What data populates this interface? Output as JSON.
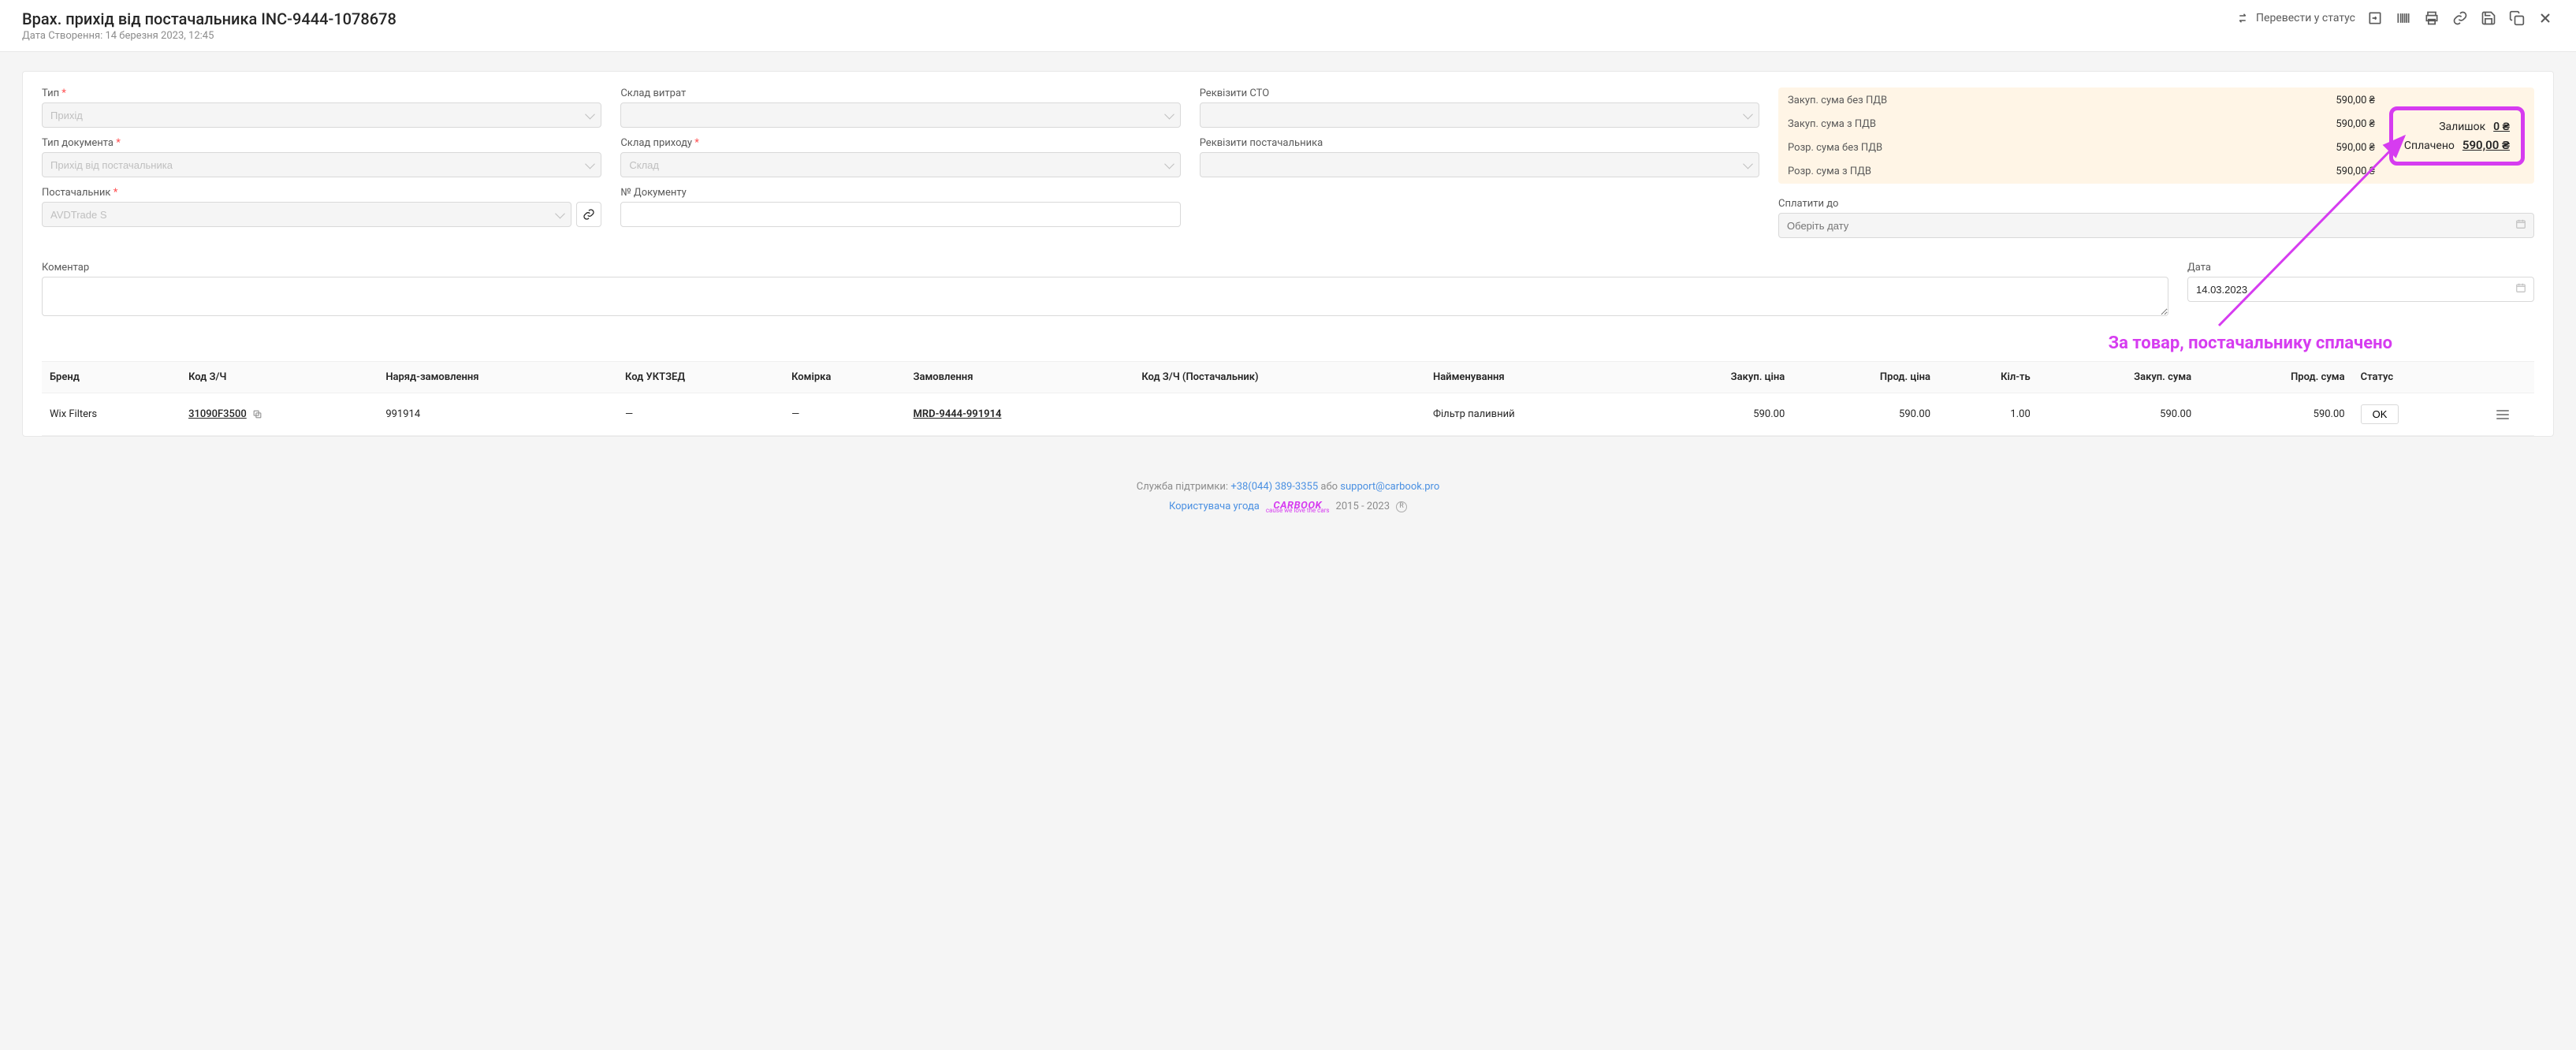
{
  "header": {
    "title": "Врах. прихід від постачальника INC-9444-1078678",
    "subtitle": "Дата Створення: 14 березня 2023, 12:45",
    "status_label": "Перевести у статус"
  },
  "form": {
    "type": {
      "label": "Тип",
      "value": "Прихід"
    },
    "doc_type": {
      "label": "Тип документа",
      "value": "Прихід від постачальника"
    },
    "supplier": {
      "label": "Постачальник",
      "value": "AVDTrade S"
    },
    "expense_wh": {
      "label": "Склад витрат",
      "value": ""
    },
    "income_wh": {
      "label": "Склад приходу",
      "value": "Склад"
    },
    "doc_no": {
      "label": "№ Документу",
      "value": ""
    },
    "sto_req": {
      "label": "Реквізити СТО",
      "value": ""
    },
    "supp_req": {
      "label": "Реквізити постачальника",
      "value": ""
    }
  },
  "summary": {
    "buy_no_vat": {
      "label": "Закуп. сума без ПДВ",
      "value": "590,00 ₴"
    },
    "buy_vat": {
      "label": "Закуп. сума з ПДВ",
      "value": "590,00 ₴"
    },
    "calc_no_vat": {
      "label": "Розр. сума без ПДВ",
      "value": "590,00 ₴"
    },
    "calc_vat": {
      "label": "Розр. сума з ПДВ",
      "value": "590,00 ₴"
    },
    "balance": {
      "label": "Залишок",
      "value": "0 ₴"
    },
    "paid": {
      "label": "Сплачено",
      "value": "590,00 ₴"
    },
    "pay_until": {
      "label": "Сплатити до",
      "placeholder": "Оберіть дату"
    },
    "date": {
      "label": "Дата",
      "value": "14.03.2023"
    }
  },
  "comment": {
    "label": "Коментар",
    "value": ""
  },
  "annotation": "За товар, постачальнику сплачено",
  "table": {
    "headers": {
      "brand": "Бренд",
      "code": "Код З/Ч",
      "order": "Наряд-замовлення",
      "uktzed": "Код УКТЗЕД",
      "cell": "Комірка",
      "order2": "Замовлення",
      "supp_code": "Код З/Ч (Постачальник)",
      "name": "Найменування",
      "buy_price": "Закуп. ціна",
      "sell_price": "Прод. ціна",
      "qty": "Кіл-ть",
      "buy_sum": "Закуп. сума",
      "sell_sum": "Прод. сума",
      "status": "Статус"
    },
    "rows": [
      {
        "brand": "Wix Filters",
        "code": "31090F3500",
        "order": "991914",
        "uktzed": "—",
        "cell": "—",
        "order2": "MRD-9444-991914",
        "supp_code": "",
        "name": "Фільтр паливний",
        "buy_price": "590.00",
        "sell_price": "590.00",
        "qty": "1.00",
        "buy_sum": "590.00",
        "sell_sum": "590.00",
        "status": "OK"
      }
    ]
  },
  "footer": {
    "support_label": "Служба підтримки: ",
    "phone": "+38(044) 389-3355",
    "or": " або ",
    "email": "support@carbook.pro",
    "user_agreement": "Користувача угода",
    "logo": "CARBOOK",
    "logo_sub": "cause we love the cars",
    "years": "2015 - 2023",
    "copyright": "R"
  }
}
